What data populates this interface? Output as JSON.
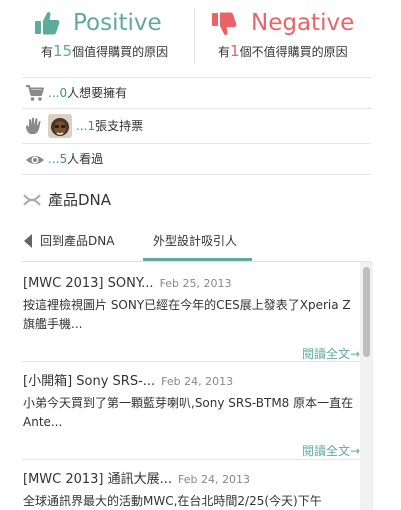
{
  "positive": {
    "word": "Positive",
    "sub_pre": "有",
    "count": "15",
    "sub_post": "個值得購買的原因",
    "color": "#5fab9b",
    "icon": "thumbs-up-icon"
  },
  "negative": {
    "word": "Negative",
    "sub_pre": "有",
    "count": "1",
    "sub_post": "個不值得購買的原因",
    "color": "#e86466",
    "icon": "thumbs-down-icon"
  },
  "stats": {
    "want": {
      "prefix": "...",
      "count": "0",
      "label": "人想要擁有",
      "icon": "cart-icon"
    },
    "support": {
      "prefix": "...",
      "count": "1",
      "label": "張支持票",
      "icon": "hand-icon"
    },
    "views": {
      "prefix": "...",
      "count": "5",
      "label": "人看過",
      "icon": "eye-icon"
    }
  },
  "dna": {
    "title": "產品DNA",
    "icon": "dna-icon"
  },
  "tabs": {
    "back_label": "回到產品DNA",
    "active_label": "外型設計吸引人"
  },
  "news": [
    {
      "title": "[MWC 2013] SONY...",
      "date": "Feb 25, 2013",
      "body": "按這裡檢視圖片 SONY已經在今年的CES展上發表了Xperia Z旗艦手機...",
      "read_more": "閱讀全文→"
    },
    {
      "title": "[小開箱] Sony SRS-...",
      "date": "Feb 24, 2013",
      "body": "小弟今天買到了第一顆藍芽喇叭,Sony SRS-BTM8 原本一直在Ante...",
      "read_more": "閱讀全文→"
    },
    {
      "title": "[MWC 2013] 通訊大展...",
      "date": "Feb 24, 2013",
      "body": "全球通訊界最大的活動MWC,在台北時間2/25(今天)下午",
      "read_more": ""
    }
  ],
  "colors": {
    "accent": "#5fab9b",
    "negative": "#e86466",
    "link": "#3e8aa8"
  }
}
